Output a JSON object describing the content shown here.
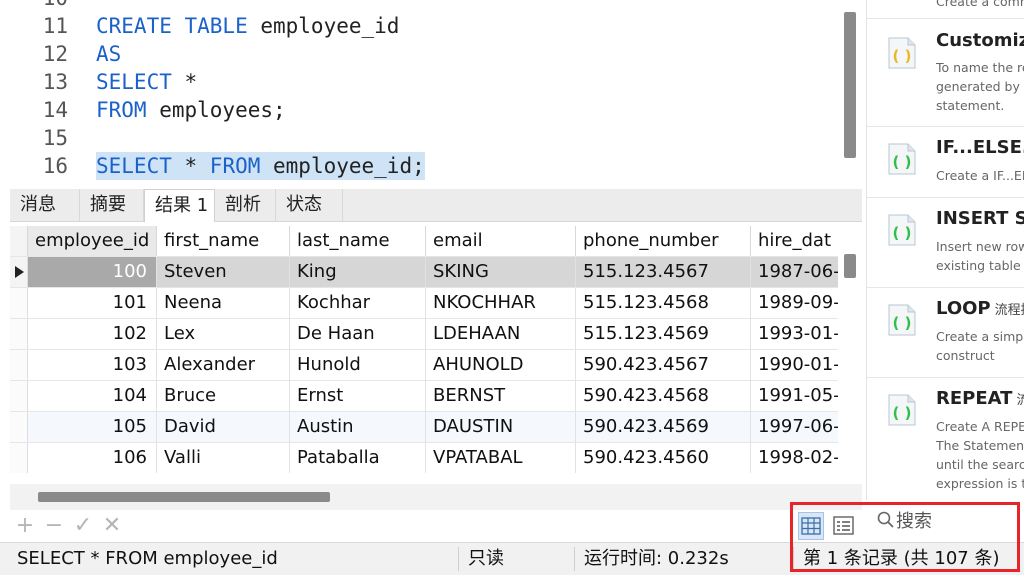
{
  "editor": {
    "lines": [
      {
        "n": "10",
        "tokens": [
          {
            "t": "",
            "c": ""
          }
        ]
      },
      {
        "n": "11",
        "tokens": [
          {
            "t": "CREATE TABLE",
            "c": "kw"
          },
          {
            "t": " employee_id",
            "c": ""
          }
        ]
      },
      {
        "n": "12",
        "tokens": [
          {
            "t": "AS",
            "c": "kw"
          }
        ]
      },
      {
        "n": "13",
        "tokens": [
          {
            "t": "SELECT",
            "c": "kw"
          },
          {
            "t": " *",
            "c": ""
          }
        ]
      },
      {
        "n": "14",
        "tokens": [
          {
            "t": "FROM",
            "c": "kw"
          },
          {
            "t": " employees;",
            "c": ""
          }
        ]
      },
      {
        "n": "15",
        "tokens": [
          {
            "t": "",
            "c": ""
          }
        ]
      },
      {
        "n": "16",
        "tokens": [
          {
            "t": "SELECT",
            "c": "kw"
          },
          {
            "t": " * ",
            "c": ""
          },
          {
            "t": "FROM",
            "c": "kw"
          },
          {
            "t": " employee_id;",
            "c": ""
          }
        ],
        "highlighted": true
      }
    ]
  },
  "result_tabs": [
    {
      "label": "消息",
      "active": false
    },
    {
      "label": "摘要",
      "active": false
    },
    {
      "label": "结果 1",
      "active": true
    },
    {
      "label": "剖析",
      "active": false
    },
    {
      "label": "状态",
      "active": false
    }
  ],
  "grid": {
    "columns": [
      "employee_id",
      "first_name",
      "last_name",
      "email",
      "phone_number",
      "hire_dat"
    ],
    "rows": [
      [
        "100",
        "Steven",
        "King",
        "SKING",
        "515.123.4567",
        "1987-06-"
      ],
      [
        "101",
        "Neena",
        "Kochhar",
        "NKOCHHAR",
        "515.123.4568",
        "1989-09-"
      ],
      [
        "102",
        "Lex",
        "De Haan",
        "LDEHAAN",
        "515.123.4569",
        "1993-01-"
      ],
      [
        "103",
        "Alexander",
        "Hunold",
        "AHUNOLD",
        "590.423.4567",
        "1990-01-"
      ],
      [
        "104",
        "Bruce",
        "Ernst",
        "BERNST",
        "590.423.4568",
        "1991-05-"
      ],
      [
        "105",
        "David",
        "Austin",
        "DAUSTIN",
        "590.423.4569",
        "1997-06-"
      ],
      [
        "106",
        "Valli",
        "Pataballa",
        "VPATABAL",
        "590.423.4560",
        "1998-02-"
      ]
    ],
    "selected_row": 0,
    "hover_row": 5
  },
  "toolbar": {
    "add": "+",
    "remove": "−",
    "apply": "✓",
    "discard": "✕"
  },
  "search": {
    "icon": "magnifier-icon",
    "label": "搜索"
  },
  "status": {
    "query": "SELECT * FROM employee_id",
    "readonly": "只读",
    "runtime": "运行时间: 0.232s",
    "records": "第 1 条记录 (共 107 条)"
  },
  "snippets": [
    {
      "title": "",
      "sub": "",
      "desc": [
        "Create a comm"
      ]
    },
    {
      "title": "Customize",
      "sub": "",
      "desc": [
        "To name the re",
        "generated by e",
        "statement."
      ]
    },
    {
      "title": "IF...ELSE...",
      "sub": "",
      "desc": [
        "Create a IF...EL"
      ]
    },
    {
      "title": "INSERT Sy",
      "sub": "",
      "desc": [
        "Insert new row",
        "existing table"
      ]
    },
    {
      "title": "LOOP",
      "sub": "流程控",
      "desc": [
        "Create a simple",
        "construct"
      ]
    },
    {
      "title": "REPEAT",
      "sub": "流",
      "desc": [
        "Create A REPEA",
        "The Statement",
        "until the search",
        "expression is tr"
      ]
    }
  ],
  "colors": {
    "keyword": "#1a62c9",
    "highlight": "#cfe3f7",
    "snippet_icon": "#2fbf4a",
    "snippet_icon_alt": "#e8b82a",
    "annotation_box": "#e8242b"
  }
}
